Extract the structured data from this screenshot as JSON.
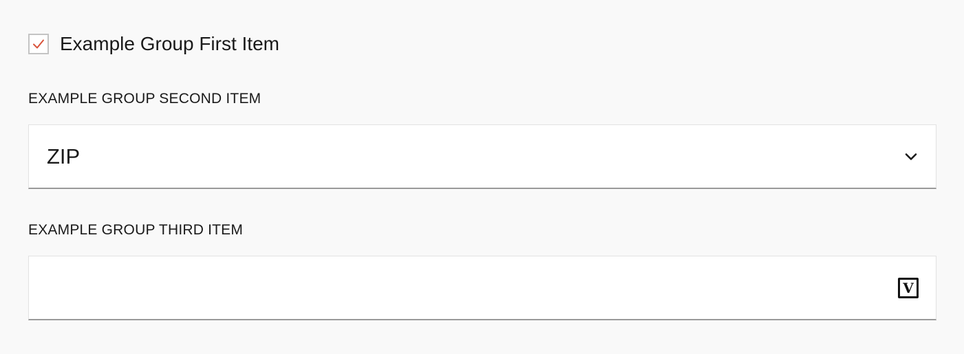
{
  "colors": {
    "check_accent": "#d9533b",
    "background": "#f9f9f9",
    "field_background": "#ffffff",
    "field_underline": "#9a9a9a"
  },
  "first_item": {
    "label": "Example Group First Item",
    "checked": true,
    "icon": "checkmark-icon"
  },
  "second_item": {
    "label": "EXAMPLE GROUP SECOND ITEM",
    "selected_value": "ZIP",
    "icon": "chevron-down-icon"
  },
  "third_item": {
    "label": "EXAMPLE GROUP THIRD ITEM",
    "value": "",
    "icon_text": "V",
    "icon": "v-badge-icon"
  }
}
